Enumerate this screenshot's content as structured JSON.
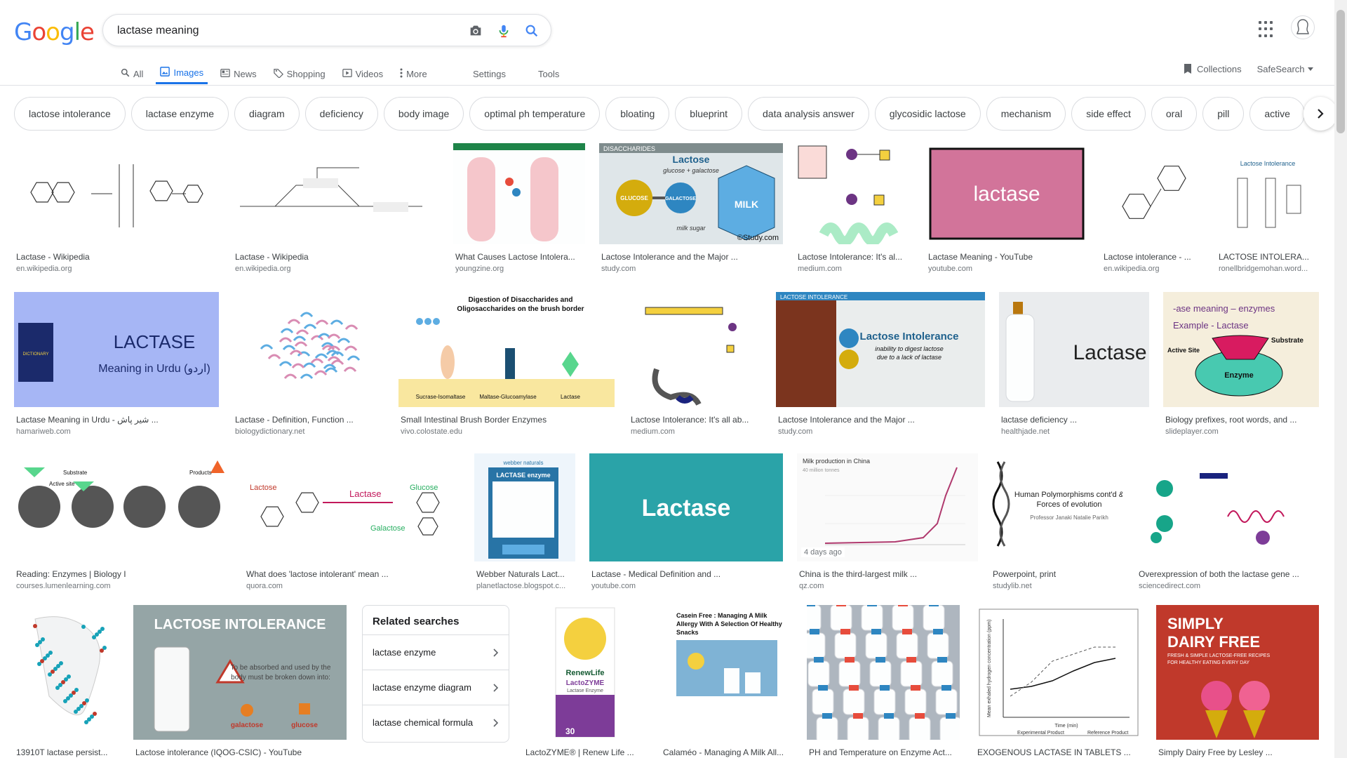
{
  "header": {
    "logo_letters": [
      {
        "char": "G",
        "color": "#4285F4"
      },
      {
        "char": "o",
        "color": "#EA4335"
      },
      {
        "char": "o",
        "color": "#FBBC05"
      },
      {
        "char": "g",
        "color": "#4285F4"
      },
      {
        "char": "l",
        "color": "#34A853"
      },
      {
        "char": "e",
        "color": "#EA4335"
      }
    ],
    "search_value": "lactase meaning",
    "icons": [
      "camera-icon",
      "microphone-icon",
      "search-icon",
      "apps-icon",
      "avatar"
    ]
  },
  "tabs": [
    {
      "label": "All",
      "icon": "search-icon",
      "active": false
    },
    {
      "label": "Images",
      "icon": "image-icon",
      "active": true
    },
    {
      "label": "News",
      "icon": "news-icon",
      "active": false
    },
    {
      "label": "Shopping",
      "icon": "tag-icon",
      "active": false
    },
    {
      "label": "Videos",
      "icon": "play-icon",
      "active": false
    },
    {
      "label": "More",
      "icon": "more-vert-icon",
      "active": false
    }
  ],
  "tools": {
    "settings": "Settings",
    "tools": "Tools"
  },
  "right_tools": {
    "collections": "Collections",
    "safesearch": "SafeSearch"
  },
  "chips": [
    "lactose intolerance",
    "lactase enzyme",
    "diagram",
    "deficiency",
    "body image",
    "optimal ph temperature",
    "bloating",
    "blueprint",
    "data analysis answer",
    "glycosidic lactose",
    "mechanism",
    "side effect",
    "oral",
    "pill",
    "active"
  ],
  "results": [
    {
      "title": "Lactase - Wikipedia",
      "source": "en.wikipedia.org"
    },
    {
      "title": "Lactase - Wikipedia",
      "source": "en.wikipedia.org"
    },
    {
      "title": "What Causes Lactose Intolera...",
      "source": "youngzine.org"
    },
    {
      "title": "Lactose Intolerance and the Major ...",
      "source": "study.com",
      "thumb_text": "Lactose",
      "thumb_text2": "glucose + galactose",
      "thumb_text3": "milk sugar",
      "thumb_text4": "©Study.com",
      "thumb_text5": "MILK",
      "thumb_text6": "GLUCOSE",
      "thumb_text7": "GALACTOSE",
      "thumb_text8": "DISACCHARIDES"
    },
    {
      "title": "Lactose Intolerance: It's al...",
      "source": "medium.com"
    },
    {
      "title": "Lactase Meaning - YouTube",
      "source": "youtube.com",
      "thumb_text": "lactase"
    },
    {
      "title": "Lactose intolerance - ...",
      "source": "en.wikipedia.org"
    },
    {
      "title": "LACTOSE INTOLERA...",
      "source": "ronellbridgemohan.word...",
      "thumb_text": "Lactose Intolerance"
    },
    {
      "title": "Lactase Meaning in Urdu - شیر پاش ...",
      "source": "hamariweb.com",
      "thumb_text": "LACTASE",
      "thumb_text2": "Meaning in Urdu (اردو)",
      "thumb_text3": "DICTIONARY"
    },
    {
      "title": "Lactase - Definition, Function ...",
      "source": "biologydictionary.net"
    },
    {
      "title": "Small Intestinal Brush Border Enzymes",
      "source": "vivo.colostate.edu",
      "thumb_text": "Digestion of Disaccharides and",
      "thumb_text2": "Oligosaccharides on the brush border",
      "thumb_text3": "Sucrase-Isomaltase",
      "thumb_text4": "Maltase-Glucoamylase",
      "thumb_text5": "Lactase"
    },
    {
      "title": "Lactose Intolerance: It's all ab...",
      "source": "medium.com"
    },
    {
      "title": "Lactose Intolerance and the Major ...",
      "source": "study.com",
      "thumb_text": "Lactose Intolerance",
      "thumb_text2": "inability to digest lactose",
      "thumb_text3": "due to a lack of lactase",
      "thumb_text4": "LACTOSE INTOLERANCE"
    },
    {
      "title": "lactase deficiency ...",
      "source": "healthjade.net",
      "thumb_text": "Lactase"
    },
    {
      "title": "Biology prefixes, root words, and ...",
      "source": "slideplayer.com",
      "thumb_text": "-ase meaning – enzymes",
      "thumb_text2": "Example - Lactase",
      "thumb_text3": "Substrate",
      "thumb_text4": "Enzyme",
      "thumb_text5": "Active Site"
    },
    {
      "title": "Reading: Enzymes | Biology I",
      "source": "courses.lumenlearning.com",
      "thumb_text": "Substrate",
      "thumb_text2": "Active site",
      "thumb_text3": "Products"
    },
    {
      "title": "What does 'lactose intolerant' mean ...",
      "source": "quora.com",
      "thumb_text": "Lactose",
      "thumb_text2": "Lactase",
      "thumb_text3": "Glucose",
      "thumb_text4": "Galactose"
    },
    {
      "title": "Webber Naturals Lact...",
      "source": "planetlactose.blogspot.c...",
      "thumb_text": "LACTASE enzyme",
      "thumb_text2": "webber naturals"
    },
    {
      "title": "Lactase - Medical Definition and ...",
      "source": "youtube.com",
      "thumb_text": "Lactase"
    },
    {
      "title": "China is the third-largest milk ...",
      "source": "qz.com",
      "badge": "4 days ago",
      "thumb_text": "Milk production in China",
      "thumb_text2": "40 million tonnes"
    },
    {
      "title": "Powerpoint, print",
      "source": "studylib.net",
      "thumb_text": "Human Polymorphisms cont'd &",
      "thumb_text2": "Forces of evolution",
      "thumb_text3": "Professor Janaki Natalie Parikh"
    },
    {
      "title": "Overexpression of both the lactase gene ...",
      "source": "sciencedirect.com"
    },
    {
      "title": "13910T lactase persist...",
      "source": ""
    },
    {
      "title": "Lactose intolerance (IQOG-CSIC) - YouTube",
      "source": "",
      "thumb_text": "LACTOSE INTOLERANCE",
      "thumb_text2": "To be absorbed and used by the",
      "thumb_text3": "body must be broken down into:",
      "thumb_text4": "galactose",
      "thumb_text5": "glucose"
    },
    {
      "title": "LactoZYME® | Renew Life ...",
      "source": "",
      "thumb_text": "RenewLife",
      "thumb_text2": "LactoZYME",
      "thumb_text3": "Lactase Enzyme",
      "thumb_text4": "30"
    },
    {
      "title": "Calaméo - Managing A Milk All...",
      "source": "",
      "thumb_text": "Casein Free : Managing A Milk",
      "thumb_text2": "Allergy With A Selection Of Healthy",
      "thumb_text3": "Snacks"
    },
    {
      "title": "PH and Temperature on Enzyme Act...",
      "source": ""
    },
    {
      "title": "EXOGENOUS LACTASE IN TABLETS ...",
      "source": "",
      "thumb_text": "Experimental Product",
      "thumb_text2": "Reference Product",
      "thumb_text3": "Time (min)",
      "thumb_text4": "Mean exhaled hydrogen concentration (ppm)"
    },
    {
      "title": "Simply Dairy Free by Lesley ...",
      "source": "",
      "thumb_text": "SIMPLY",
      "thumb_text2": "DAIRY FREE",
      "thumb_text3": "FRESH & SIMPLE LACTOSE-FREE RECIPES",
      "thumb_text4": "FOR HEALTHY EATING EVERY DAY"
    }
  ],
  "related": {
    "title": "Related searches",
    "items": [
      "lactase enzyme",
      "lactase enzyme diagram",
      "lactase chemical formula"
    ]
  },
  "colors": {
    "accent": "#1a73e8",
    "border": "#dfe1e5",
    "muted": "#70757a"
  }
}
